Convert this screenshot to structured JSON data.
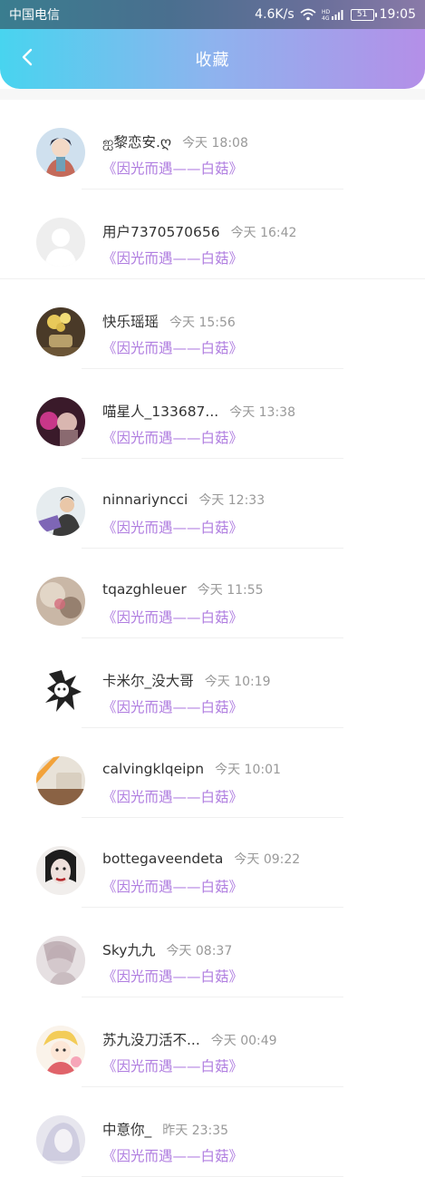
{
  "status_bar": {
    "carrier": "中国电信",
    "speed": "4.6K/s",
    "battery": "51",
    "time": "19:05"
  },
  "header": {
    "title": "收藏",
    "back_icon": "chevron-left-icon"
  },
  "items": [
    {
      "name": "ஐ黎恋安.ღ",
      "time": "今天 18:08",
      "link": "《因光而遇——白菇》",
      "avatar": "anime-boy"
    },
    {
      "name": "用户7370570656",
      "time": "今天 16:42",
      "link": "《因光而遇——白菇》",
      "avatar": "default"
    },
    {
      "name": "快乐瑶瑶",
      "time": "今天 15:56",
      "link": "《因光而遇——白菇》",
      "avatar": "flowers"
    },
    {
      "name": "喵星人_133687...",
      "time": "今天 13:38",
      "link": "《因光而遇——白菇》",
      "avatar": "pink-photo"
    },
    {
      "name": "ninnariyncci",
      "time": "今天 12:33",
      "link": "《因光而遇——白菇》",
      "avatar": "person"
    },
    {
      "name": "tqazghleuer",
      "time": "今天 11:55",
      "link": "《因光而遇——白菇》",
      "avatar": "blurry"
    },
    {
      "name": "卡米尔_没大哥",
      "time": "今天 10:19",
      "link": "《因光而遇——白菇》",
      "avatar": "manga"
    },
    {
      "name": "calvingklqeipn",
      "time": "今天 10:01",
      "link": "《因光而遇——白菇》",
      "avatar": "orange"
    },
    {
      "name": "bottegaveendeta",
      "time": "今天 09:22",
      "link": "《因光而遇——白菇》",
      "avatar": "portrait"
    },
    {
      "name": "Sky九九",
      "time": "今天 08:37",
      "link": "《因光而遇——白菇》",
      "avatar": "sketch"
    },
    {
      "name": "苏九没刀活不...",
      "time": "今天 00:49",
      "link": "《因光而遇——白菇》",
      "avatar": "cartoon"
    },
    {
      "name": "中意你_",
      "time": "昨天 23:35",
      "link": "《因光而遇——白菇》",
      "avatar": "pale"
    }
  ]
}
